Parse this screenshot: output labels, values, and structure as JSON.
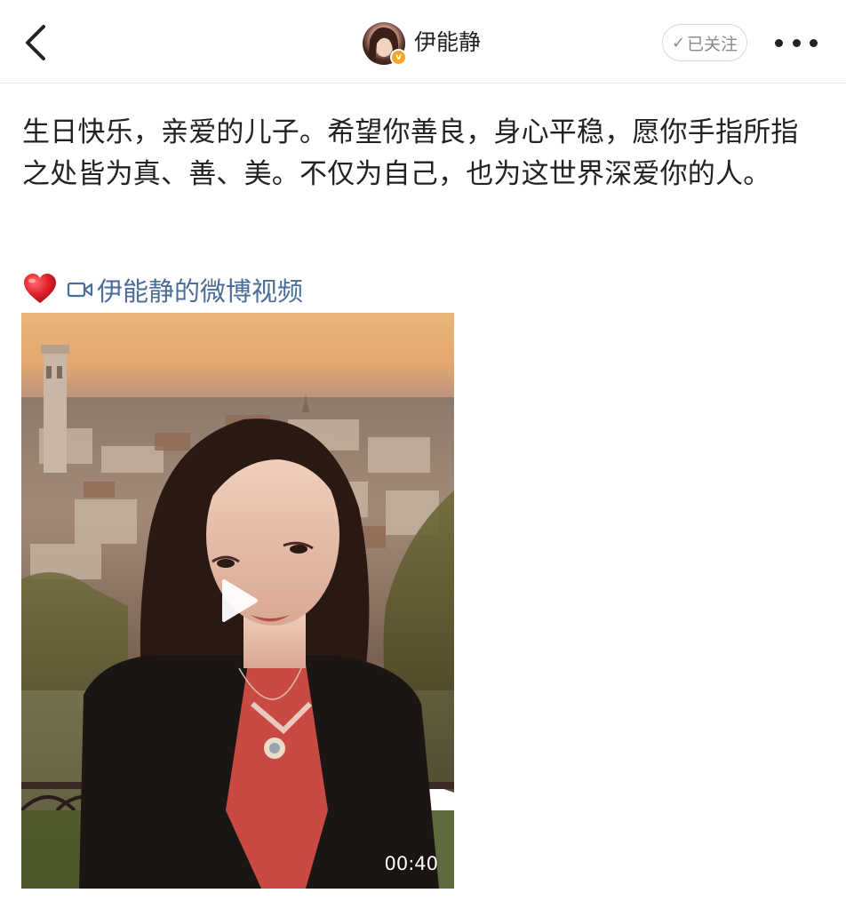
{
  "header": {
    "username": "伊能静",
    "follow_label": "已关注",
    "follow_check": "✓",
    "verified_mark": "v"
  },
  "post": {
    "text": "生日快乐，亲爱的儿子。希望你善良，身心平稳，愿你手指所指之处皆为真、善、美。不仅为自己，也为这世界深爱你的人。",
    "video_link_label": "伊能静的微博视频",
    "video_duration": "00:40"
  },
  "colors": {
    "link": "#4a6d99",
    "text": "#222222",
    "badge": "#f5a623"
  },
  "icons": {
    "back": "chevron-left-icon",
    "more": "more-dots-icon",
    "heart": "heart-icon",
    "camera": "video-camera-icon",
    "play": "play-icon"
  }
}
